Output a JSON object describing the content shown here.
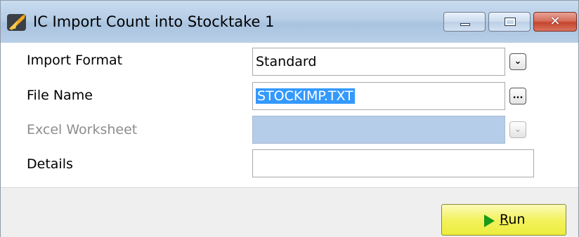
{
  "window": {
    "title": "IC Import Count into Stocktake 1",
    "icon": "app-logo-icon",
    "controls": {
      "minimize_icon": "minimize-icon",
      "maximize_icon": "maximize-icon",
      "close_icon": "close-icon",
      "close_glyph": "✕"
    }
  },
  "form": {
    "import_format": {
      "label": "Import Format",
      "value": "Standard",
      "button_icon": "chevron-down-icon",
      "button_glyph": "⌄"
    },
    "file_name": {
      "label": "File Name",
      "value": "STOCKIMP.TXT",
      "button_icon": "ellipsis-icon",
      "button_glyph": "..."
    },
    "excel_worksheet": {
      "label": "Excel Worksheet",
      "value": "",
      "disabled": true,
      "button_icon": "chevron-down-icon",
      "button_glyph": "⌄"
    },
    "details": {
      "label": "Details",
      "value": ""
    }
  },
  "actions": {
    "run": {
      "label_prefix": "",
      "label_mnemonic": "R",
      "label_rest": "un",
      "icon": "play-icon"
    }
  },
  "colors": {
    "title_bar": "#b6cde6",
    "run_button": "#f3f25f",
    "selection": "#3399ff",
    "disabled_field": "#b6cde9",
    "play_icon": "#1a9a1a"
  }
}
